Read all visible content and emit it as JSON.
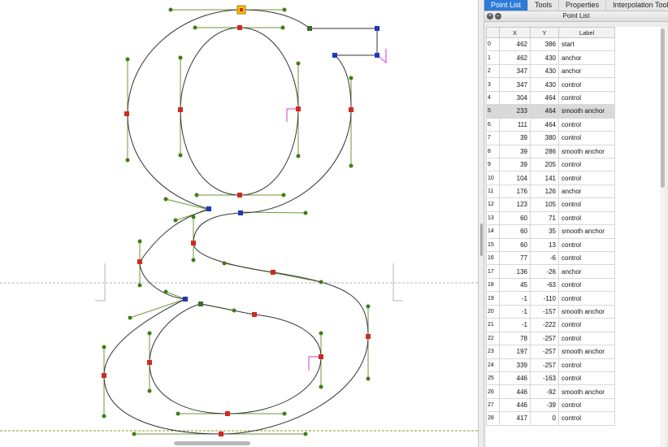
{
  "tabs": [
    {
      "label": "Point List",
      "active": true
    },
    {
      "label": "Tools",
      "active": false
    },
    {
      "label": "Properties",
      "active": false
    },
    {
      "label": "Interpolation Tool",
      "active": false
    }
  ],
  "panel": {
    "title": "Point List",
    "close_icon": "close-icon",
    "minimize_icon": "minimize-icon",
    "columns": [
      "X",
      "Y",
      "Label"
    ],
    "selected_row": 5,
    "rows": [
      {
        "idx": "0",
        "x": "462",
        "y": "386",
        "label": "start"
      },
      {
        "idx": "1",
        "x": "462",
        "y": "430",
        "label": "anchor"
      },
      {
        "idx": "2",
        "x": "347",
        "y": "430",
        "label": "anchor"
      },
      {
        "idx": "3",
        "x": "347",
        "y": "430",
        "label": "control"
      },
      {
        "idx": "4",
        "x": "304",
        "y": "464",
        "label": "control"
      },
      {
        "idx": "5",
        "x": "233",
        "y": "464",
        "label": "smooth anchor"
      },
      {
        "idx": "6",
        "x": "111",
        "y": "464",
        "label": "control"
      },
      {
        "idx": "7",
        "x": "39",
        "y": "380",
        "label": "control"
      },
      {
        "idx": "8",
        "x": "39",
        "y": "286",
        "label": "smooth anchor"
      },
      {
        "idx": "9",
        "x": "39",
        "y": "205",
        "label": "control"
      },
      {
        "idx": "10",
        "x": "104",
        "y": "141",
        "label": "control"
      },
      {
        "idx": "11",
        "x": "176",
        "y": "126",
        "label": "anchor"
      },
      {
        "idx": "12",
        "x": "123",
        "y": "105",
        "label": "control"
      },
      {
        "idx": "13",
        "x": "60",
        "y": "71",
        "label": "control"
      },
      {
        "idx": "14",
        "x": "60",
        "y": "35",
        "label": "smooth anchor"
      },
      {
        "idx": "15",
        "x": "60",
        "y": "13",
        "label": "control"
      },
      {
        "idx": "16",
        "x": "77",
        "y": "-6",
        "label": "control"
      },
      {
        "idx": "17",
        "x": "136",
        "y": "-26",
        "label": "anchor"
      },
      {
        "idx": "18",
        "x": "45",
        "y": "-63",
        "label": "control"
      },
      {
        "idx": "19",
        "x": "-1",
        "y": "-110",
        "label": "control"
      },
      {
        "idx": "20",
        "x": "-1",
        "y": "-157",
        "label": "smooth anchor"
      },
      {
        "idx": "21",
        "x": "-1",
        "y": "-222",
        "label": "control"
      },
      {
        "idx": "22",
        "x": "78",
        "y": "-257",
        "label": "control"
      },
      {
        "idx": "23",
        "x": "197",
        "y": "-257",
        "label": "smooth anchor"
      },
      {
        "idx": "24",
        "x": "339",
        "y": "-257",
        "label": "control"
      },
      {
        "idx": "25",
        "x": "446",
        "y": "-163",
        "label": "control"
      },
      {
        "idx": "26",
        "x": "446",
        "y": "-92",
        "label": "smooth anchor"
      },
      {
        "idx": "27",
        "x": "446",
        "y": "-39",
        "label": "control"
      },
      {
        "idx": "28",
        "x": "417",
        "y": "0",
        "label": "control"
      }
    ]
  },
  "colors": {
    "accent": "#2e7ad7",
    "curve": "#333333",
    "handle_line": "#5e8f2e",
    "handle_point": "#3f7d14",
    "smooth_anchor": "#d02a1f",
    "corner_anchor": "#1f37b8",
    "start_point": "#f2c200",
    "guide": "#b6b6b6",
    "baseline": "#8a9a2a",
    "direction": "#d13ad8"
  }
}
